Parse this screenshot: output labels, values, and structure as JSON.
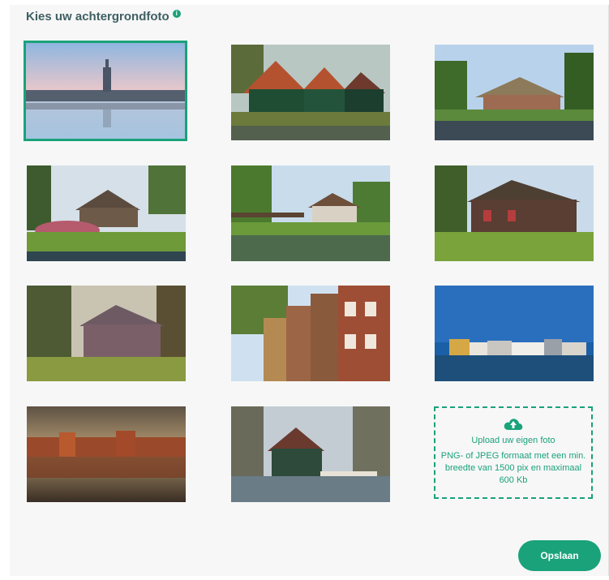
{
  "header": {
    "title": "Kies uw achtergrondfoto",
    "info_icon": "info-icon"
  },
  "photos": [
    {
      "name": "photo-city-skyline-water",
      "selected": true
    },
    {
      "name": "photo-green-wooden-houses-canal",
      "selected": false
    },
    {
      "name": "photo-thatched-farmhouse-canal",
      "selected": false
    },
    {
      "name": "photo-farmhouse-flower-garden",
      "selected": false
    },
    {
      "name": "photo-canal-footbridge-village",
      "selected": false
    },
    {
      "name": "photo-thatched-cottage-trees",
      "selected": false
    },
    {
      "name": "photo-brick-house-autumn",
      "selected": false
    },
    {
      "name": "photo-canal-houses-facades",
      "selected": false
    },
    {
      "name": "photo-waterfront-row-houses",
      "selected": false
    },
    {
      "name": "photo-sunset-houses-reflection",
      "selected": false
    },
    {
      "name": "photo-green-house-bridge",
      "selected": false
    }
  ],
  "upload": {
    "icon": "cloud-upload-icon",
    "title": "Upload uw eigen foto",
    "description": "PNG- of JPEG formaat met een min. breedte van 1500 pix en maximaal 600 Kb"
  },
  "actions": {
    "save_label": "Opslaan"
  },
  "colors": {
    "accent": "#1aa27a",
    "title": "#3f5f63",
    "background": "#f7f7f7"
  }
}
